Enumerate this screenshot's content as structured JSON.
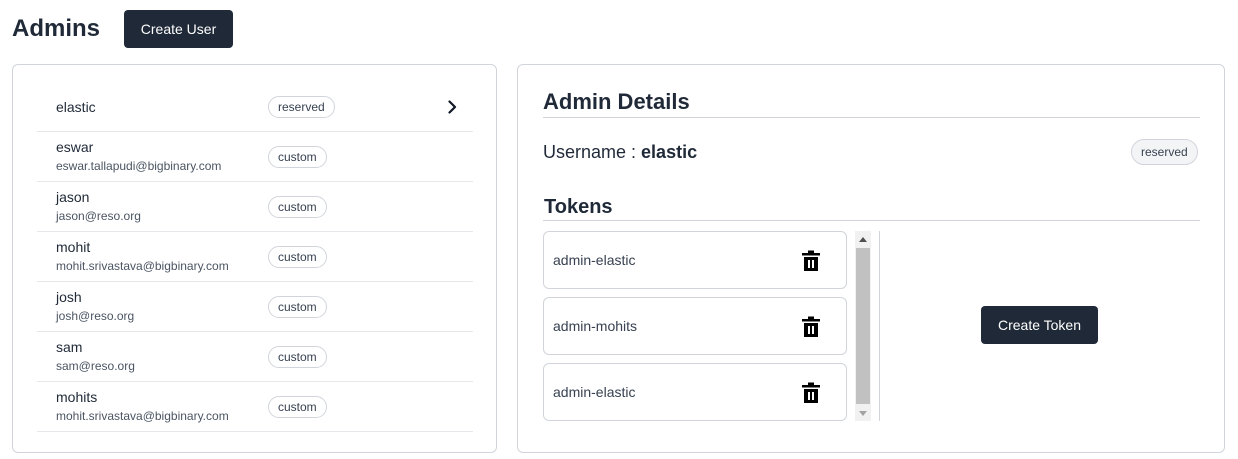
{
  "header": {
    "title": "Admins",
    "create_user_label": "Create User"
  },
  "users": [
    {
      "name": "elastic",
      "email": "",
      "role": "reserved",
      "selected": true
    },
    {
      "name": "eswar",
      "email": "eswar.tallapudi@bigbinary.com",
      "role": "custom"
    },
    {
      "name": "jason",
      "email": "jason@reso.org",
      "role": "custom"
    },
    {
      "name": "mohit",
      "email": "mohit.srivastava@bigbinary.com",
      "role": "custom"
    },
    {
      "name": "josh",
      "email": "josh@reso.org",
      "role": "custom"
    },
    {
      "name": "sam",
      "email": "sam@reso.org",
      "role": "custom"
    },
    {
      "name": "mohits",
      "email": "mohit.srivastava@bigbinary.com",
      "role": "custom"
    }
  ],
  "details": {
    "title": "Admin Details",
    "username_label": "Username : ",
    "username_value": "elastic",
    "role_badge": "reserved",
    "tokens_title": "Tokens",
    "tokens": [
      {
        "name": "admin-elastic"
      },
      {
        "name": "admin-mohits"
      },
      {
        "name": "admin-elastic"
      }
    ],
    "create_token_label": "Create Token"
  },
  "icons": {
    "chevron": "chevron-right-icon",
    "delete": "trash-icon"
  },
  "colors": {
    "primary_dark": "#1f2937",
    "border": "#d1d5db"
  }
}
